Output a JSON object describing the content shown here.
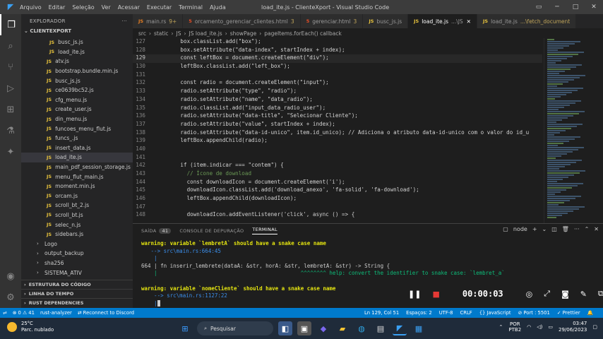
{
  "titlebar": {
    "menu": [
      "Arquivo",
      "Editar",
      "Seleção",
      "Ver",
      "Acessar",
      "Executar",
      "Terminal",
      "Ajuda"
    ],
    "title": "load_ite.js - ClienteXport - Visual Studio Code"
  },
  "sidebar": {
    "header": "EXPLORADOR",
    "root": "CLIENTEXPORT",
    "files": [
      {
        "name": "busc_js.js",
        "type": "js",
        "indent": 2
      },
      {
        "name": "load_ite.js",
        "type": "js",
        "indent": 2
      },
      {
        "name": "atv.js",
        "type": "js",
        "indent": 1
      },
      {
        "name": "bootstrap.bundle.min.js",
        "type": "js",
        "indent": 1
      },
      {
        "name": "busc_js.js",
        "type": "js",
        "indent": 1
      },
      {
        "name": "ce0639bc52.js",
        "type": "js",
        "indent": 1
      },
      {
        "name": "cfg_menu.js",
        "type": "js",
        "indent": 1
      },
      {
        "name": "create_user.js",
        "type": "js",
        "indent": 1
      },
      {
        "name": "din_menu.js",
        "type": "js",
        "indent": 1
      },
      {
        "name": "funcoes_menu_flut.js",
        "type": "js",
        "indent": 1
      },
      {
        "name": "funcs_.js",
        "type": "js",
        "indent": 1
      },
      {
        "name": "insert_data.js",
        "type": "js",
        "indent": 1
      },
      {
        "name": "load_ite.js",
        "type": "js",
        "indent": 1,
        "selected": true
      },
      {
        "name": "main_pdf_session_storage.js",
        "type": "js",
        "indent": 1
      },
      {
        "name": "menu_flut_main.js",
        "type": "js",
        "indent": 1
      },
      {
        "name": "moment.min.js",
        "type": "js",
        "indent": 1
      },
      {
        "name": "orcam.js",
        "type": "js",
        "indent": 1
      },
      {
        "name": "scroll_bt_2.js",
        "type": "js",
        "indent": 1
      },
      {
        "name": "scroll_bt.js",
        "type": "js",
        "indent": 1
      },
      {
        "name": "selec_n.js",
        "type": "js",
        "indent": 1
      },
      {
        "name": "sidebars.js",
        "type": "js",
        "indent": 1
      },
      {
        "name": "Logo",
        "type": "folder",
        "indent": 0
      },
      {
        "name": "output_backup",
        "type": "folder",
        "indent": 0
      },
      {
        "name": "sha256",
        "type": "folder",
        "indent": 0
      },
      {
        "name": "SISTEMA_ATIV",
        "type": "folder",
        "indent": 0
      }
    ],
    "sections": [
      "ESTRUTURA DO CÓDIGO",
      "LINHA DO TEMPO",
      "RUST DEPENDENCIES"
    ]
  },
  "tabs": [
    {
      "icon": "JS",
      "label": "main.rs",
      "mod": "9+",
      "color": "#e67e22"
    },
    {
      "icon": "5",
      "label": "orcamento_gerenciar_clientes.html",
      "mod": "3",
      "color": "#e44d26"
    },
    {
      "icon": "5",
      "label": "gerenciar.html",
      "mod": "3",
      "color": "#e44d26"
    },
    {
      "icon": "JS",
      "label": "busc_js.js",
      "mod": "",
      "color": "#e8c33c"
    },
    {
      "icon": "JS",
      "label": "load_ite.js",
      "mod": "...\\JS",
      "color": "#e8c33c",
      "active": true
    },
    {
      "icon": "JS",
      "label": "load_ite.js",
      "mod": "...\\fetch_document",
      "color": "#e8c33c"
    }
  ],
  "breadcrumbs": [
    "src",
    "›",
    "static",
    "›",
    "JS",
    "›",
    "JS load_ite.js",
    "›",
    "showPage",
    "›",
    "pageItems.forEach() callback"
  ],
  "code": [
    {
      "n": "127",
      "t": "      box.classList.add(\"box\");"
    },
    {
      "n": "128",
      "t": "      box.setAttribute(\"data-index\", startIndex + index);"
    },
    {
      "n": "129",
      "t": "      const leftBox = document.createElement(\"div\");",
      "cur": true
    },
    {
      "n": "130",
      "t": "      leftBox.classList.add(\"left_box\");"
    },
    {
      "n": "131",
      "t": ""
    },
    {
      "n": "132",
      "t": "      const radio = document.createElement(\"input\");"
    },
    {
      "n": "133",
      "t": "      radio.setAttribute(\"type\", \"radio\");"
    },
    {
      "n": "134",
      "t": "      radio.setAttribute(\"name\", \"data_radio\");"
    },
    {
      "n": "135",
      "t": "      radio.classList.add(\"input_data_radio_user\");"
    },
    {
      "n": "136",
      "t": "      radio.setAttribute(\"data-title\", \"Selecionar Cliente\");"
    },
    {
      "n": "137",
      "t": "      radio.setAttribute(\"value\", startIndex + index);"
    },
    {
      "n": "138",
      "t": "      radio.setAttribute(\"data-id-unico\", item.id_unico); // Adiciona o atributo data-id-unico com o valor do id_u"
    },
    {
      "n": "139",
      "t": "      leftBox.appendChild(radio);"
    },
    {
      "n": "140",
      "t": ""
    },
    {
      "n": "141",
      "t": ""
    },
    {
      "n": "142",
      "t": "      if (item.indicar === \"contem\") {"
    },
    {
      "n": "143",
      "t": "        // Ícone de download"
    },
    {
      "n": "144",
      "t": "        const downloadIcon = document.createElement('i');"
    },
    {
      "n": "145",
      "t": "        downloadIcon.classList.add('download_anexo', 'fa-solid', 'fa-download');"
    },
    {
      "n": "146",
      "t": "        leftBox.appendChild(downloadIcon);"
    },
    {
      "n": "147",
      "t": ""
    },
    {
      "n": "148",
      "t": "        downloadIcon.addEventListener('click', async () => {"
    }
  ],
  "panel": {
    "tabs": [
      {
        "label": "SAÍDA",
        "badge": "41"
      },
      {
        "label": "CONSOLE DE DEPURAÇÃO"
      },
      {
        "label": "TERMINAL",
        "active": true
      }
    ],
    "shell": "node"
  },
  "terminal": [
    {
      "kind": "warn",
      "text": "warning: variable `lembretA` should have a snake case name"
    },
    {
      "kind": "arrow",
      "text": "   --> src\\main.rs:664:45"
    },
    {
      "kind": "bar",
      "text": "    |"
    },
    {
      "kind": "code",
      "text": "664 | fn inserir_lembrete(dataA: &str, horA: &str, lembretA: &str) -> String {"
    },
    {
      "kind": "help",
      "text": "    |                                             ^^^^^^^^ help: convert the identifier to snake case: `lembret_a`"
    },
    {
      "kind": "bar",
      "text": ""
    },
    {
      "kind": "warn",
      "text": "warning: variable `nomeCliente` should have a snake case name"
    },
    {
      "kind": "arrow",
      "text": "    --> src\\main.rs:1127:22"
    }
  ],
  "recorder": {
    "timer": "00:00:03"
  },
  "status": {
    "left": [
      "⊗ 0 ⚠ 41",
      "rust-analyzer",
      "⇄ Reconnect to Discord"
    ],
    "right": [
      "Ln 129, Col 51",
      "Espaços: 2",
      "UTF-8",
      "CRLF",
      "{} JavaScript",
      "⊘ Port : 5501",
      "✓ Prettier"
    ]
  },
  "taskbar": {
    "temp": "25°C",
    "weather": "Parc. nublado",
    "search": "Pesquisar",
    "lang1": "POR",
    "lang2": "PTB2",
    "time": "03:47",
    "date": "29/06/2023"
  }
}
